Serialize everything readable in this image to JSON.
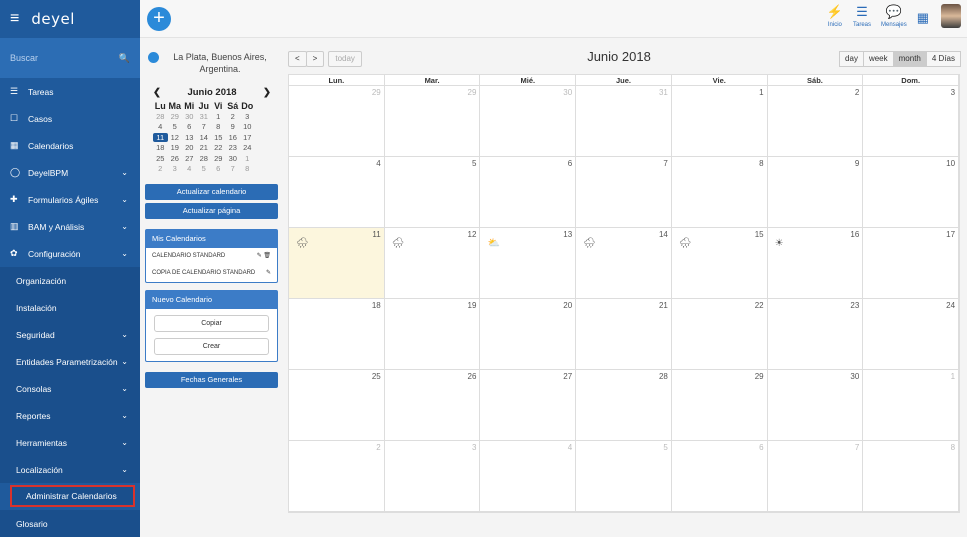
{
  "top": {
    "hamburger": "≡",
    "logo": "deyel",
    "add": "+",
    "icons": [
      {
        "name": "inicio-icon",
        "glyph": "⚡",
        "label": "Inicio"
      },
      {
        "name": "tareas-icon",
        "glyph": "☰",
        "label": "Tareas"
      },
      {
        "name": "mensajes-icon",
        "glyph": "💬",
        "label": "Mensajes"
      },
      {
        "name": "apps-grid-icon",
        "glyph": "▦",
        "label": ""
      }
    ]
  },
  "sidebar": {
    "search_placeholder": "Buscar",
    "search_icon": "🔍",
    "items": [
      {
        "label": "Tareas",
        "icon": "☰",
        "chev": ""
      },
      {
        "label": "Casos",
        "icon": "☐",
        "chev": ""
      },
      {
        "label": "Calendarios",
        "icon": "▦",
        "chev": ""
      },
      {
        "label": "DeyelBPM",
        "icon": "◯",
        "chev": "⌄"
      },
      {
        "label": "Formularios Ágiles",
        "icon": "✚",
        "chev": "⌄"
      },
      {
        "label": "BAM y Análisis",
        "icon": "▥",
        "chev": "⌄"
      },
      {
        "label": "Configuración",
        "icon": "✿",
        "chev": "⌄"
      }
    ],
    "subitems": [
      {
        "label": "Organización",
        "chev": ""
      },
      {
        "label": "Instalación",
        "chev": ""
      },
      {
        "label": "Seguridad",
        "chev": "⌄"
      },
      {
        "label": "Entidades Parametrización",
        "chev": "⌄"
      },
      {
        "label": "Consolas",
        "chev": "⌄"
      },
      {
        "label": "Reportes",
        "chev": "⌄"
      },
      {
        "label": "Herramientas",
        "chev": "⌄"
      },
      {
        "label": "Localización",
        "chev": "⌄"
      },
      {
        "label": "Administrar Calendarios",
        "chev": "",
        "active": true
      },
      {
        "label": "Glosario",
        "chev": ""
      }
    ]
  },
  "panel": {
    "location": "La Plata, Buenos Aires, Argentina.",
    "mini": {
      "title": "Junio 2018",
      "prev": "❮",
      "next": "❯",
      "days": [
        "Lu",
        "Ma",
        "Mi",
        "Ju",
        "Vi",
        "Sá",
        "Do"
      ],
      "weeks": [
        [
          "28",
          "29",
          "30",
          "31",
          "1",
          "2",
          "3"
        ],
        [
          "4",
          "5",
          "6",
          "7",
          "8",
          "9",
          "10"
        ],
        [
          "11",
          "12",
          "13",
          "14",
          "15",
          "16",
          "17"
        ],
        [
          "18",
          "19",
          "20",
          "21",
          "22",
          "23",
          "24"
        ],
        [
          "25",
          "26",
          "27",
          "28",
          "29",
          "30",
          "1"
        ],
        [
          "2",
          "3",
          "4",
          "5",
          "6",
          "7",
          "8"
        ]
      ]
    },
    "btn_update_cal": "Actualizar calendario",
    "btn_update_page": "Actualizar página",
    "mis": {
      "title": "Mis Calendarios",
      "items": [
        "CALENDARIO STANDARD",
        "COPIA DE CALENDARIO STANDARD"
      ]
    },
    "nuevo": {
      "title": "Nuevo Calendario",
      "copy": "Copiar",
      "create": "Crear"
    },
    "fechas": "Fechas Generales"
  },
  "calendar": {
    "prev": "<",
    "next": ">",
    "today": "today",
    "title": "Junio 2018",
    "views": [
      "day",
      "week",
      "month",
      "4 Días"
    ],
    "active_view": "month",
    "dow": [
      "Lun.",
      "Mar.",
      "Mié.",
      "Jue.",
      "Vie.",
      "Sáb.",
      "Dom."
    ],
    "weeks": [
      [
        "29",
        "29",
        "30",
        "31",
        "1",
        "2",
        "3"
      ],
      [
        "4",
        "5",
        "6",
        "7",
        "8",
        "9",
        "10"
      ],
      [
        "11",
        "12",
        "13",
        "14",
        "15",
        "16",
        "17"
      ],
      [
        "18",
        "19",
        "20",
        "21",
        "22",
        "23",
        "24"
      ],
      [
        "25",
        "26",
        "27",
        "28",
        "29",
        "30",
        "1"
      ],
      [
        "2",
        "3",
        "4",
        "5",
        "6",
        "7",
        "8"
      ]
    ],
    "weather": {
      "11": "🌧",
      "12": "🌧",
      "13": "⛅",
      "14": "🌧",
      "15": "🌧",
      "16": "☀"
    }
  }
}
